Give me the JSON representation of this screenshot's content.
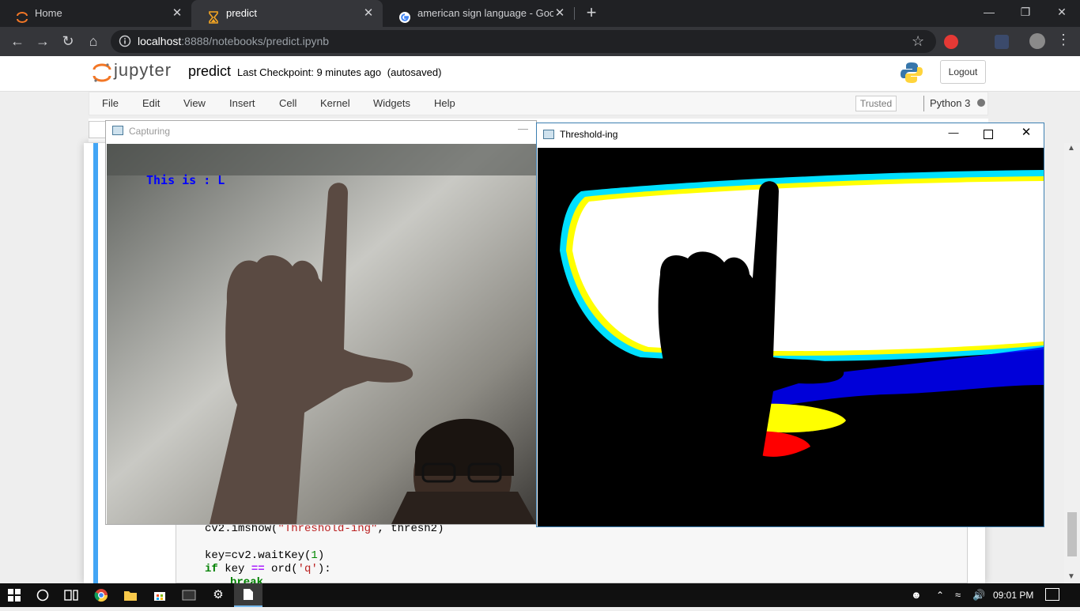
{
  "browser": {
    "tabs": [
      {
        "label": "Home",
        "icon": "jupyter-icon",
        "active": false
      },
      {
        "label": "predict",
        "icon": "hourglass-icon",
        "active": true
      },
      {
        "label": "american sign language - Google",
        "icon": "google-icon",
        "active": false
      }
    ],
    "url_host": "localhost",
    "url_rest": ":8888/notebooks/predict.ipynb"
  },
  "jupyter": {
    "logo_text": "jupyter",
    "notebook_name": "predict",
    "checkpoint_label": "Last Checkpoint:",
    "checkpoint_time": "9 minutes ago",
    "autosave": "(autosaved)",
    "logout": "Logout",
    "menu": [
      "File",
      "Edit",
      "View",
      "Insert",
      "Cell",
      "Kernel",
      "Widgets",
      "Help"
    ],
    "trusted": "Trusted",
    "kernel": "Python 3"
  },
  "code": {
    "line1_pre": "cv2.imshow(",
    "line1_str": "\"Threshold-ing\"",
    "line1_post": ", thresh2)",
    "line2_pre": "key=cv2.waitKey(",
    "line2_num": "1",
    "line2_post": ")",
    "line3_kw": "if",
    "line3_mid": " key ",
    "line3_op": "==",
    "line3_fn": " ord(",
    "line3_str": "'q'",
    "line3_end": "):",
    "line4_kw": "break"
  },
  "windows": {
    "capture_title": "Capturing",
    "capture_overlay": "This is : L",
    "threshold_title": "Threshold-ing"
  },
  "taskbar": {
    "time": "09:01 PM"
  },
  "colors": {
    "tab_bg": "#202124",
    "toolbar_bg": "#35363a",
    "jupyter_orange": "#f37726",
    "cell_selected": "#42a5f5",
    "overlay_text": "#0000ff"
  }
}
